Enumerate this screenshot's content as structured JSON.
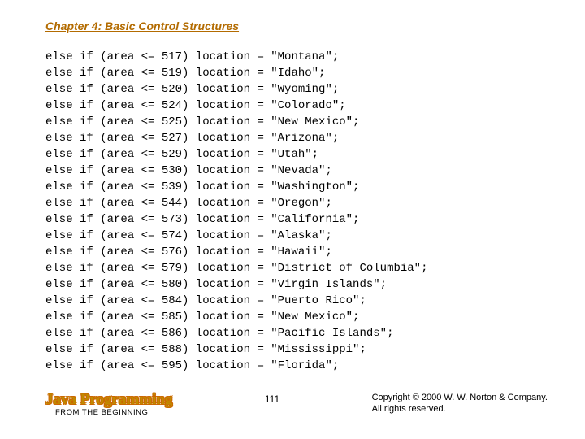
{
  "chapter_title": "Chapter 4: Basic Control Structures",
  "code_lines": [
    {
      "area": 517,
      "location": "Montana"
    },
    {
      "area": 519,
      "location": "Idaho"
    },
    {
      "area": 520,
      "location": "Wyoming"
    },
    {
      "area": 524,
      "location": "Colorado"
    },
    {
      "area": 525,
      "location": "New Mexico"
    },
    {
      "area": 527,
      "location": "Arizona"
    },
    {
      "area": 529,
      "location": "Utah"
    },
    {
      "area": 530,
      "location": "Nevada"
    },
    {
      "area": 539,
      "location": "Washington"
    },
    {
      "area": 544,
      "location": "Oregon"
    },
    {
      "area": 573,
      "location": "California"
    },
    {
      "area": 574,
      "location": "Alaska"
    },
    {
      "area": 576,
      "location": "Hawaii"
    },
    {
      "area": 579,
      "location": "District of Columbia"
    },
    {
      "area": 580,
      "location": "Virgin Islands"
    },
    {
      "area": 584,
      "location": "Puerto Rico"
    },
    {
      "area": 585,
      "location": "New Mexico"
    },
    {
      "area": 586,
      "location": "Pacific Islands"
    },
    {
      "area": 588,
      "location": "Mississippi"
    },
    {
      "area": 595,
      "location": "Florida"
    }
  ],
  "footer": {
    "book_title": "Java Programming",
    "book_subtitle": "FROM THE BEGINNING",
    "page_number": "111",
    "copyright_line1": "Copyright © 2000 W. W. Norton & Company.",
    "copyright_line2": "All rights reserved."
  }
}
